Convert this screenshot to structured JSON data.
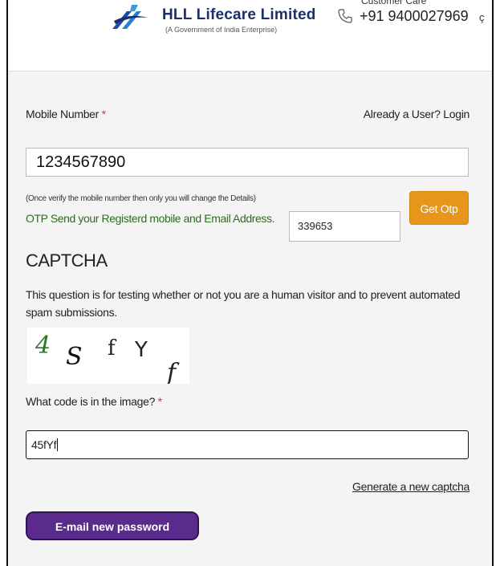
{
  "header": {
    "brand_name": "HLL Lifecare Limited",
    "brand_sub": "(A Government of India Enterprise)",
    "care_label": "Customer Care",
    "care_number": "+91 9400027969",
    "icons": [
      "logo-icon",
      "phone-icon",
      "edge-icon"
    ]
  },
  "form": {
    "mobile_label": "Mobile Number",
    "required_mark": "*",
    "login_link": "Already a User? Login",
    "mobile_value": "1234567890",
    "note": "(Once verify the mobile number then only you will change the Details)",
    "otp_message": "OTP Send your Registerd mobile and Email Address.",
    "otp_value": "339653",
    "get_otp_label": "Get Otp",
    "captcha_title": "CAPTCHA",
    "captcha_desc": "This question is for testing whether or not you are a human visitor and to prevent automated spam submissions.",
    "captcha_chars": [
      "4",
      "S",
      "f",
      "Y",
      "f"
    ],
    "code_label": "What code is in the image?",
    "code_value": "45fYf",
    "generate_link": "Generate a new captcha",
    "submit_label": "E-mail new password"
  },
  "colors": {
    "accent_orange": "#e8951c",
    "submit_purple": "#5a2a8d",
    "otp_text_green": "#2f6b22",
    "required_red": "#d9342b",
    "brand_blue": "#1b2f6b"
  }
}
